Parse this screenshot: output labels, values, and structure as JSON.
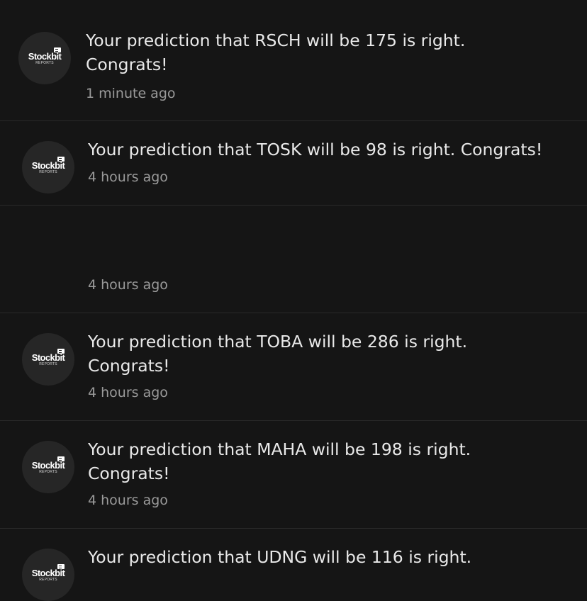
{
  "avatar": {
    "brand": "Stockbit",
    "sub": "REPORTS"
  },
  "notifications": [
    {
      "message": "Your prediction that RSCH will be 175 is right.\nCongrats!",
      "time": "1 minute ago"
    },
    {
      "message": "Your prediction that TOSK will be 98 is right. Congrats!",
      "time": "4 hours ago"
    },
    {
      "message": "",
      "time": "4 hours ago"
    },
    {
      "message": "Your prediction that TOBA will be 286 is right.\nCongrats!",
      "time": "4 hours ago"
    },
    {
      "message": "Your prediction that MAHA will be 198 is right.\nCongrats!",
      "time": "4 hours ago"
    },
    {
      "message": "Your prediction that UDNG will be 116 is right.",
      "time": ""
    }
  ],
  "colors": {
    "background": "#151515",
    "divider": "#2a2a2a",
    "avatar": "#262626",
    "message_text": "#e9e9e9",
    "time_text": "#9a9a9a"
  }
}
